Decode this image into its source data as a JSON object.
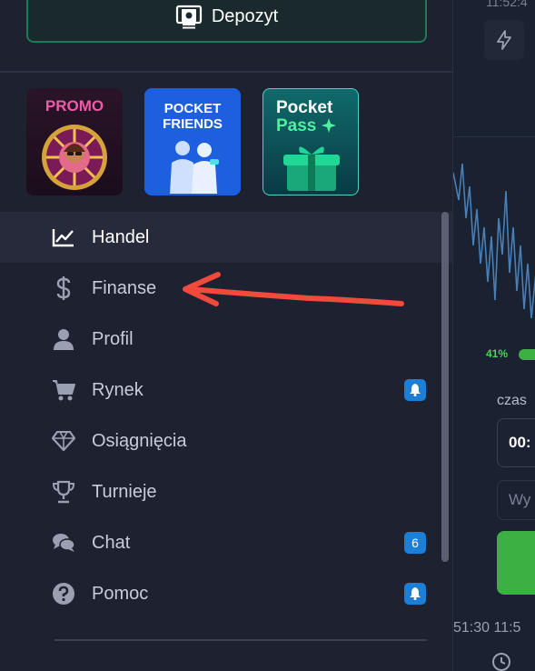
{
  "header": {
    "deposit_label": "Depozyt"
  },
  "promos": [
    {
      "name": "promo",
      "title": "PROMO"
    },
    {
      "name": "pocket-friends",
      "title": "POCKET\nFRIENDS"
    },
    {
      "name": "pocket-pass",
      "title1": "Pocket",
      "title2": "Pass"
    }
  ],
  "menu": {
    "items": [
      {
        "label": "Handel",
        "icon": "chart-line-icon",
        "active": true
      },
      {
        "label": "Finanse",
        "icon": "dollar-icon"
      },
      {
        "label": "Profil",
        "icon": "user-icon"
      },
      {
        "label": "Rynek",
        "icon": "cart-icon",
        "badge": "bell"
      },
      {
        "label": "Osiągnięcia",
        "icon": "diamond-icon"
      },
      {
        "label": "Turnieje",
        "icon": "trophy-icon"
      },
      {
        "label": "Chat",
        "icon": "chat-icon",
        "badge": "6"
      },
      {
        "label": "Pomoc",
        "icon": "help-icon",
        "badge": "bell"
      }
    ]
  },
  "background": {
    "time_top": "11:52:4",
    "percent": "41%",
    "czas_label": "czas",
    "time_value": "00:",
    "wy_label": "Wy",
    "bottom_times": "51:30  11:5"
  },
  "colors": {
    "accent_green": "#1f7a5a",
    "badge_blue": "#1d7ed6",
    "arrow_red": "#f04a3c"
  }
}
